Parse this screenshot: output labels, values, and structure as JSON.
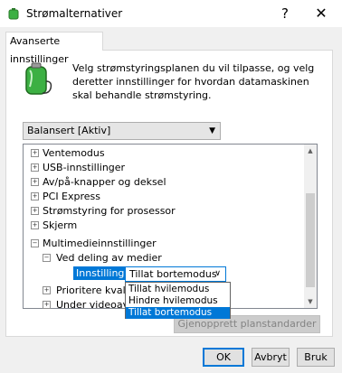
{
  "window": {
    "title": "Strømalternativer",
    "help_label": "?",
    "close_label": "✕"
  },
  "tab": {
    "label": "Avanserte innstillinger"
  },
  "description": "Velg strømstyringsplanen du vil tilpasse, og velg deretter innstillinger for hvordan datamaskinen skal behandle strømstyring.",
  "plan_select": {
    "value": "Balansert [Aktiv]"
  },
  "tree": {
    "items": [
      {
        "label": "Ventemodus",
        "expander": "+"
      },
      {
        "label": "USB-innstillinger",
        "expander": "+"
      },
      {
        "label": "Av/på-knapper og deksel",
        "expander": "+"
      },
      {
        "label": "PCI Express",
        "expander": "+"
      },
      {
        "label": "Strømstyring for prosessor",
        "expander": "+"
      },
      {
        "label": "Skjerm",
        "expander": "+"
      },
      {
        "label": "Multimedieinnstillinger",
        "expander": "−"
      },
      {
        "label": "Ved deling av medier",
        "expander": "−"
      },
      {
        "label": "Prioritere kvalit",
        "expander": "+"
      },
      {
        "label": "Under videoavs",
        "expander": "+"
      }
    ]
  },
  "setting": {
    "label": "Innstilling:",
    "value": "Tillat bortemodus",
    "options": [
      "Tillat hvilemodus",
      "Hindre hvilemodus",
      "Tillat bortemodus"
    ]
  },
  "restore_button": "Gjenopprett planstandarder",
  "buttons": {
    "ok": "OK",
    "cancel": "Avbryt",
    "apply": "Bruk"
  },
  "colors": {
    "accent": "#0078d7",
    "battery_green": "#3cb043"
  },
  "icons": {
    "app": "battery-icon",
    "plan": "battery-plug-icon",
    "help": "help-icon",
    "close": "close-icon"
  }
}
